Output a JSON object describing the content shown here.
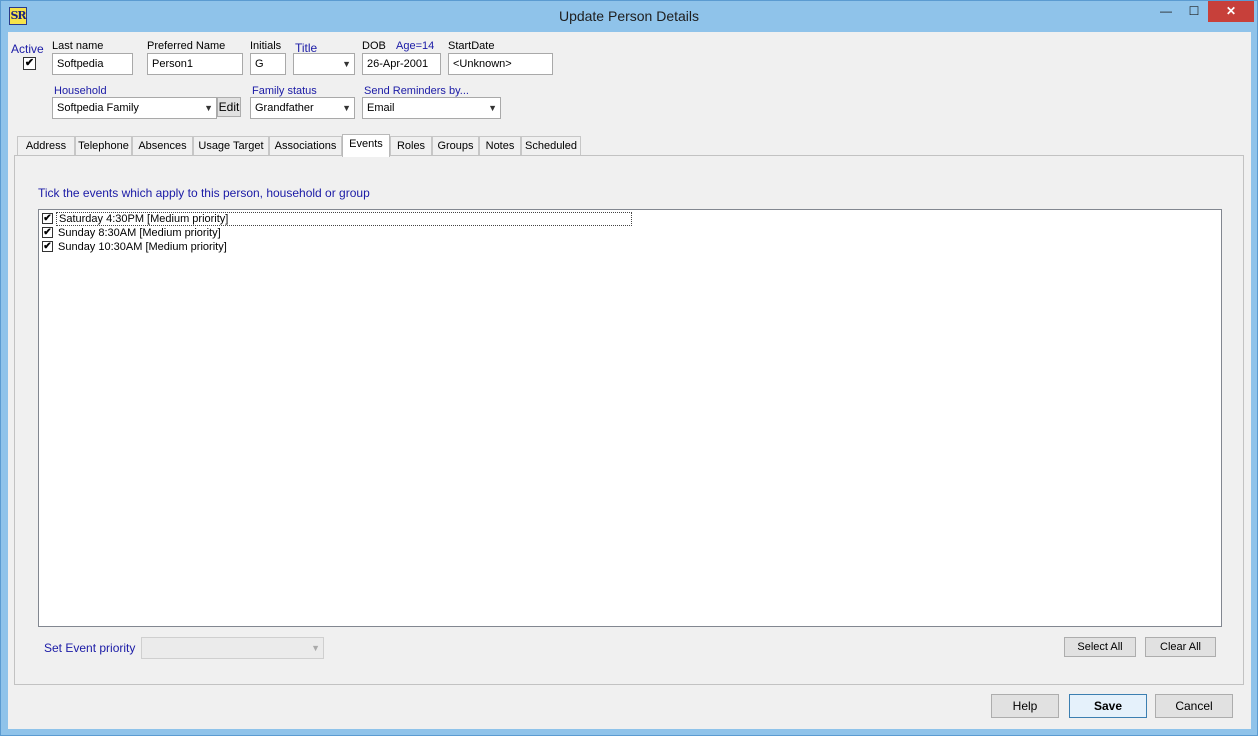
{
  "window": {
    "title": "Update Person Details",
    "icon_text": "SR",
    "controls": {
      "minimize": "—",
      "maximize": "☐",
      "close": "✕"
    }
  },
  "header": {
    "active_label": "Active",
    "active_checked": true,
    "active_mark": "✔",
    "last_name_label": "Last name",
    "last_name_value": "Softpedia",
    "preferred_name_label": "Preferred Name",
    "preferred_name_value": "Person1",
    "initials_label": "Initials",
    "initials_value": "G",
    "title_label": "Title",
    "title_value": "",
    "dob_label": "DOB",
    "age_label": "Age=14",
    "dob_value": "26-Apr-2001",
    "start_date_label": "StartDate",
    "start_date_value": "<Unknown>",
    "household_label": "Household",
    "household_value": "Softpedia Family",
    "edit_label": "Edit",
    "family_status_label": "Family status",
    "family_status_value": "Grandfather",
    "send_reminders_label": "Send Reminders by...",
    "send_reminders_value": "Email",
    "dropdown_arrow": "▼"
  },
  "tabs": [
    {
      "label": "Address"
    },
    {
      "label": "Telephone"
    },
    {
      "label": "Absences"
    },
    {
      "label": "Usage Target"
    },
    {
      "label": "Associations"
    },
    {
      "label": "Events",
      "active": true
    },
    {
      "label": "Roles"
    },
    {
      "label": "Groups"
    },
    {
      "label": "Notes"
    },
    {
      "label": "Scheduled"
    }
  ],
  "events_panel": {
    "instruction": "Tick the events which apply to this person, household or group",
    "items": [
      {
        "label": "Saturday 4:30PM [Medium priority]",
        "checked": true,
        "mark": "✔"
      },
      {
        "label": "Sunday 8:30AM [Medium priority]",
        "checked": true,
        "mark": "✔"
      },
      {
        "label": "Sunday 10:30AM [Medium priority]",
        "checked": true,
        "mark": "✔"
      }
    ],
    "set_priority_label": "Set Event priority",
    "set_priority_value": "",
    "select_all_label": "Select All",
    "clear_all_label": "Clear All"
  },
  "footer": {
    "help_label": "Help",
    "save_label": "Save",
    "cancel_label": "Cancel"
  }
}
